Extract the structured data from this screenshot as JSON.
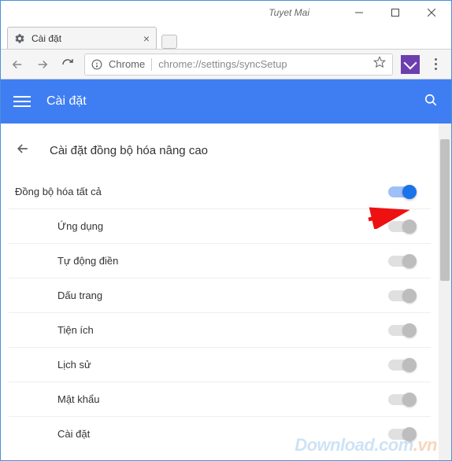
{
  "window": {
    "user_label": "Tuyet Mai"
  },
  "tab": {
    "title": "Cài đặt"
  },
  "omnibox": {
    "prefix": "Chrome",
    "url": "chrome://settings/syncSetup"
  },
  "header": {
    "title": "Cài đặt"
  },
  "section": {
    "title": "Cài đặt đồng bộ hóa nâng cao"
  },
  "sync": {
    "master": {
      "label": "Đồng bộ hóa tất cả",
      "on": true
    },
    "items": [
      {
        "label": "Ứng dụng"
      },
      {
        "label": "Tự động điền"
      },
      {
        "label": "Dấu trang"
      },
      {
        "label": "Tiện ích"
      },
      {
        "label": "Lịch sử"
      },
      {
        "label": "Mật khẩu"
      },
      {
        "label": "Cài đặt"
      }
    ]
  },
  "watermark": {
    "main": "Download",
    "suffix": ".com",
    "tld": ".vn"
  }
}
